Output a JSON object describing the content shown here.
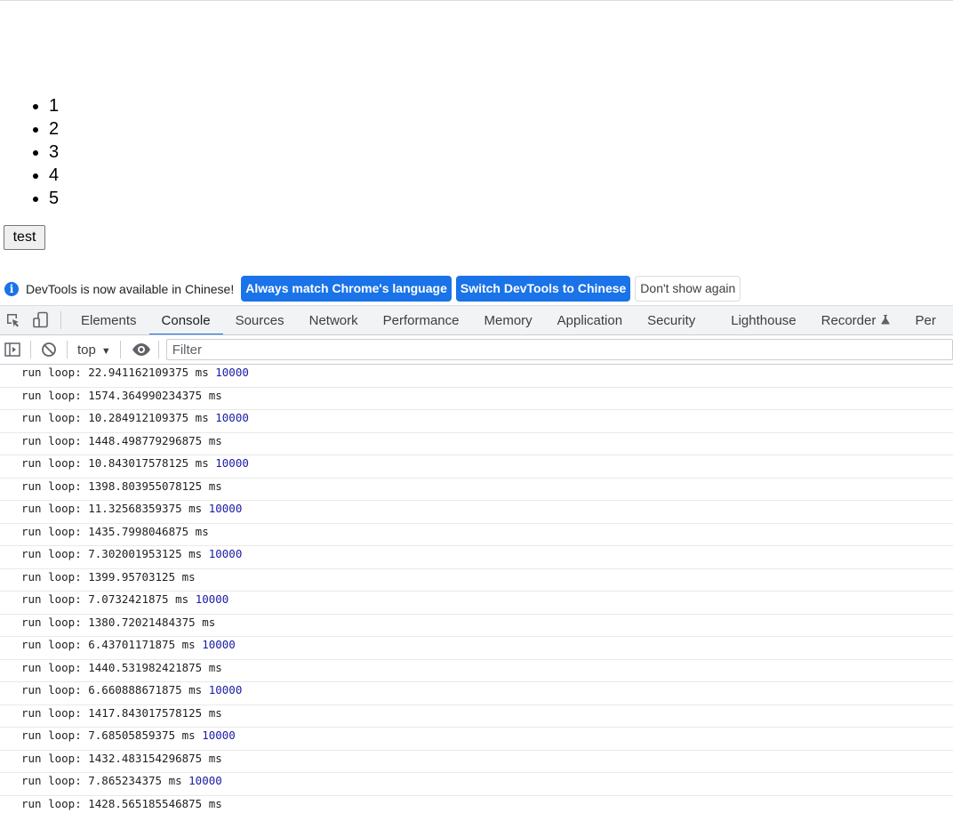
{
  "page": {
    "list_items": [
      "1",
      "2",
      "3",
      "4",
      "5"
    ],
    "button_label": "test"
  },
  "infobar": {
    "message": "DevTools is now available in Chinese!",
    "btn_match": "Always match Chrome's language",
    "btn_switch": "Switch DevTools to Chinese",
    "btn_dismiss": "Don't show again"
  },
  "tabs": [
    "Elements",
    "Console",
    "Sources",
    "Network",
    "Performance",
    "Memory",
    "Application",
    "Security",
    "Lighthouse",
    "Recorder",
    "Per"
  ],
  "active_tab": "Console",
  "console_toolbar": {
    "context": "top",
    "filter_placeholder": "Filter"
  },
  "log": [
    {
      "text": "run loop: 22.941162109375 ms",
      "count": "10000"
    },
    {
      "text": "run loop: 1574.364990234375 ms",
      "count": ""
    },
    {
      "text": "run loop: 10.284912109375 ms",
      "count": "10000"
    },
    {
      "text": "run loop: 1448.498779296875 ms",
      "count": ""
    },
    {
      "text": "run loop: 10.843017578125 ms",
      "count": "10000"
    },
    {
      "text": "run loop: 1398.803955078125 ms",
      "count": ""
    },
    {
      "text": "run loop: 11.32568359375 ms",
      "count": "10000"
    },
    {
      "text": "run loop: 1435.7998046875 ms",
      "count": ""
    },
    {
      "text": "run loop: 7.302001953125 ms",
      "count": "10000"
    },
    {
      "text": "run loop: 1399.95703125 ms",
      "count": ""
    },
    {
      "text": "run loop: 7.0732421875 ms",
      "count": "10000"
    },
    {
      "text": "run loop: 1380.72021484375 ms",
      "count": ""
    },
    {
      "text": "run loop: 6.43701171875 ms",
      "count": "10000"
    },
    {
      "text": "run loop: 1440.531982421875 ms",
      "count": ""
    },
    {
      "text": "run loop: 6.660888671875 ms",
      "count": "10000"
    },
    {
      "text": "run loop: 1417.843017578125 ms",
      "count": ""
    },
    {
      "text": "run loop: 7.68505859375 ms",
      "count": "10000"
    },
    {
      "text": "run loop: 1432.483154296875 ms",
      "count": ""
    },
    {
      "text": "run loop: 7.865234375 ms",
      "count": "10000"
    },
    {
      "text": "run loop: 1428.565185546875 ms",
      "count": ""
    }
  ],
  "colors": {
    "accent": "#1a73e8",
    "number_literal": "#1a1aa6"
  }
}
